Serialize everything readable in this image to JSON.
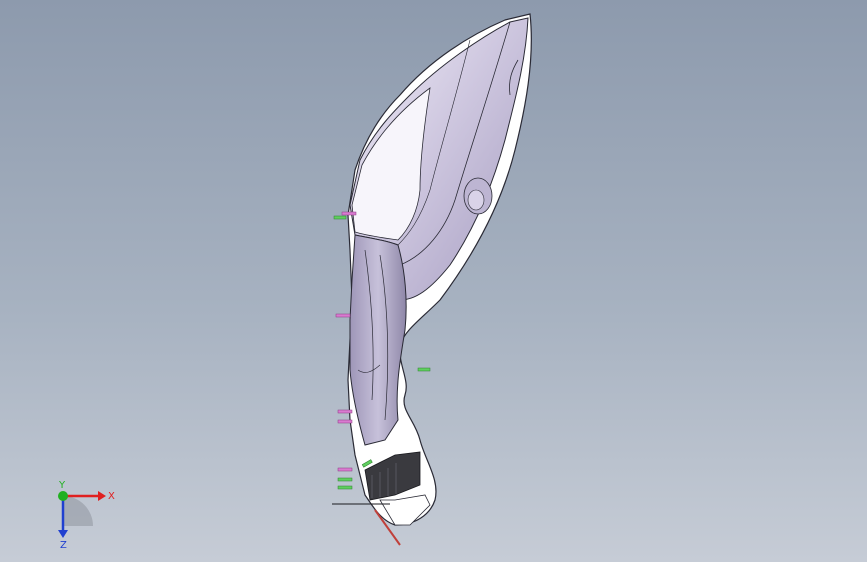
{
  "viewport": {
    "background_top": "#8d9aad",
    "background_bottom": "#c6ccd6"
  },
  "model": {
    "face_color": "#c9c3d9",
    "face_light": "#ece8f5",
    "edge_color": "#2a2a35",
    "flange_color": "#ffffff",
    "dark_insert_color": "#3a3a3f"
  },
  "mold_pins": {
    "magenta_color": "#d97ad0",
    "green_color": "#5fcf5f"
  },
  "triad": {
    "x_label": "X",
    "y_label": "Y",
    "z_label": "Z",
    "x_color": "#e02020",
    "y_color": "#20b020",
    "z_color": "#2040d0"
  }
}
